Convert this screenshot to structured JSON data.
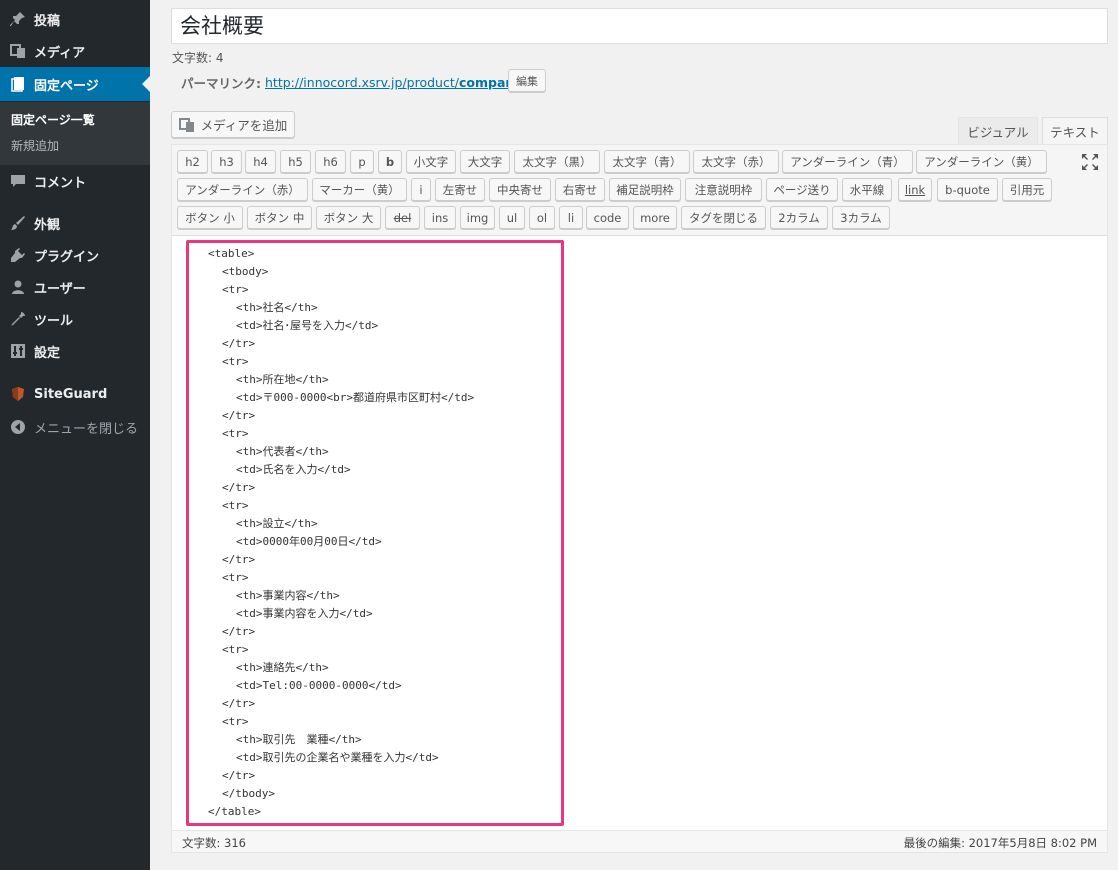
{
  "sidebar": {
    "menu": [
      {
        "label": "投稿",
        "icon": "pushpin-icon"
      },
      {
        "label": "メディア",
        "icon": "media-icon"
      },
      {
        "label": "固定ページ",
        "icon": "page-icon"
      },
      {
        "label": "コメント",
        "icon": "comment-icon"
      },
      {
        "label": "外観",
        "icon": "brush-icon"
      },
      {
        "label": "プラグイン",
        "icon": "plugin-icon"
      },
      {
        "label": "ユーザー",
        "icon": "user-icon"
      },
      {
        "label": "ツール",
        "icon": "wrench-icon"
      },
      {
        "label": "設定",
        "icon": "settings-icon"
      },
      {
        "label": "SiteGuard",
        "icon": "siteguard-icon"
      },
      {
        "label": "メニューを閉じる",
        "icon": "collapse-icon"
      }
    ],
    "submenu": [
      "固定ページ一覧",
      "新規追加"
    ]
  },
  "post": {
    "title": "会社概要",
    "word_count_top": "文字数: 4",
    "permalink_label": "パーマリンク:",
    "permalink_base": "http://innocord.xsrv.jp/product/",
    "permalink_slug": "company/",
    "edit_label": "編集"
  },
  "editor": {
    "add_media": "メディアを追加",
    "tab_visual": "ビジュアル",
    "tab_text": "テキスト",
    "buttons_row1": [
      "h2",
      "h3",
      "h4",
      "h5",
      "h6",
      "p",
      "b",
      "小文字",
      "大文字",
      "太文字（黒）",
      "太文字（青）",
      "太文字（赤）",
      "アンダーライン（青）",
      "アンダーライン（黄）"
    ],
    "buttons_row2": [
      "アンダーライン（赤）",
      "マーカー（黄）",
      "i",
      "左寄せ",
      "中央寄せ",
      "右寄せ",
      "補足説明枠",
      "注意説明枠",
      "ページ送り",
      "水平線",
      "link",
      "b-quote",
      "引用元"
    ],
    "buttons_row3": [
      "ボタン 小",
      "ボタン 中",
      "ボタン 大",
      "del",
      "ins",
      "img",
      "ul",
      "ol",
      "li",
      "code",
      "more",
      "タグを閉じる",
      "2カラム",
      "3カラム"
    ],
    "code_lines": [
      "<table>",
      "  <tbody>",
      "  <tr>",
      "    <th>社名</th>",
      "    <td>社名･屋号を入力</td>",
      "  </tr>",
      "  <tr>",
      "    <th>所在地</th>",
      "    <td>〒000-0000<br>都道府県市区町村</td>",
      "  </tr>",
      "  <tr>",
      "    <th>代表者</th>",
      "    <td>氏名を入力</td>",
      "  </tr>",
      "  <tr>",
      "    <th>設立</th>",
      "    <td>0000年00月00日</td>",
      "  </tr>",
      "  <tr>",
      "    <th>事業内容</th>",
      "    <td>事業内容を入力</td>",
      "  </tr>",
      "  <tr>",
      "    <th>連絡先</th>",
      "    <td>Tel:00-0000-0000</td>",
      "  </tr>",
      "  <tr>",
      "    <th>取引先　業種</th>",
      "    <td>取引先の企業名や業種を入力</td>",
      "  </tr>",
      "  </tbody>",
      "</table>"
    ],
    "word_count": "文字数: 316",
    "last_edited": "最後の編集: 2017年5月8日 8:02 PM"
  },
  "colors": {
    "sidebar_bg": "#23282d",
    "active": "#0073aa",
    "highlight": "#e8367f"
  }
}
